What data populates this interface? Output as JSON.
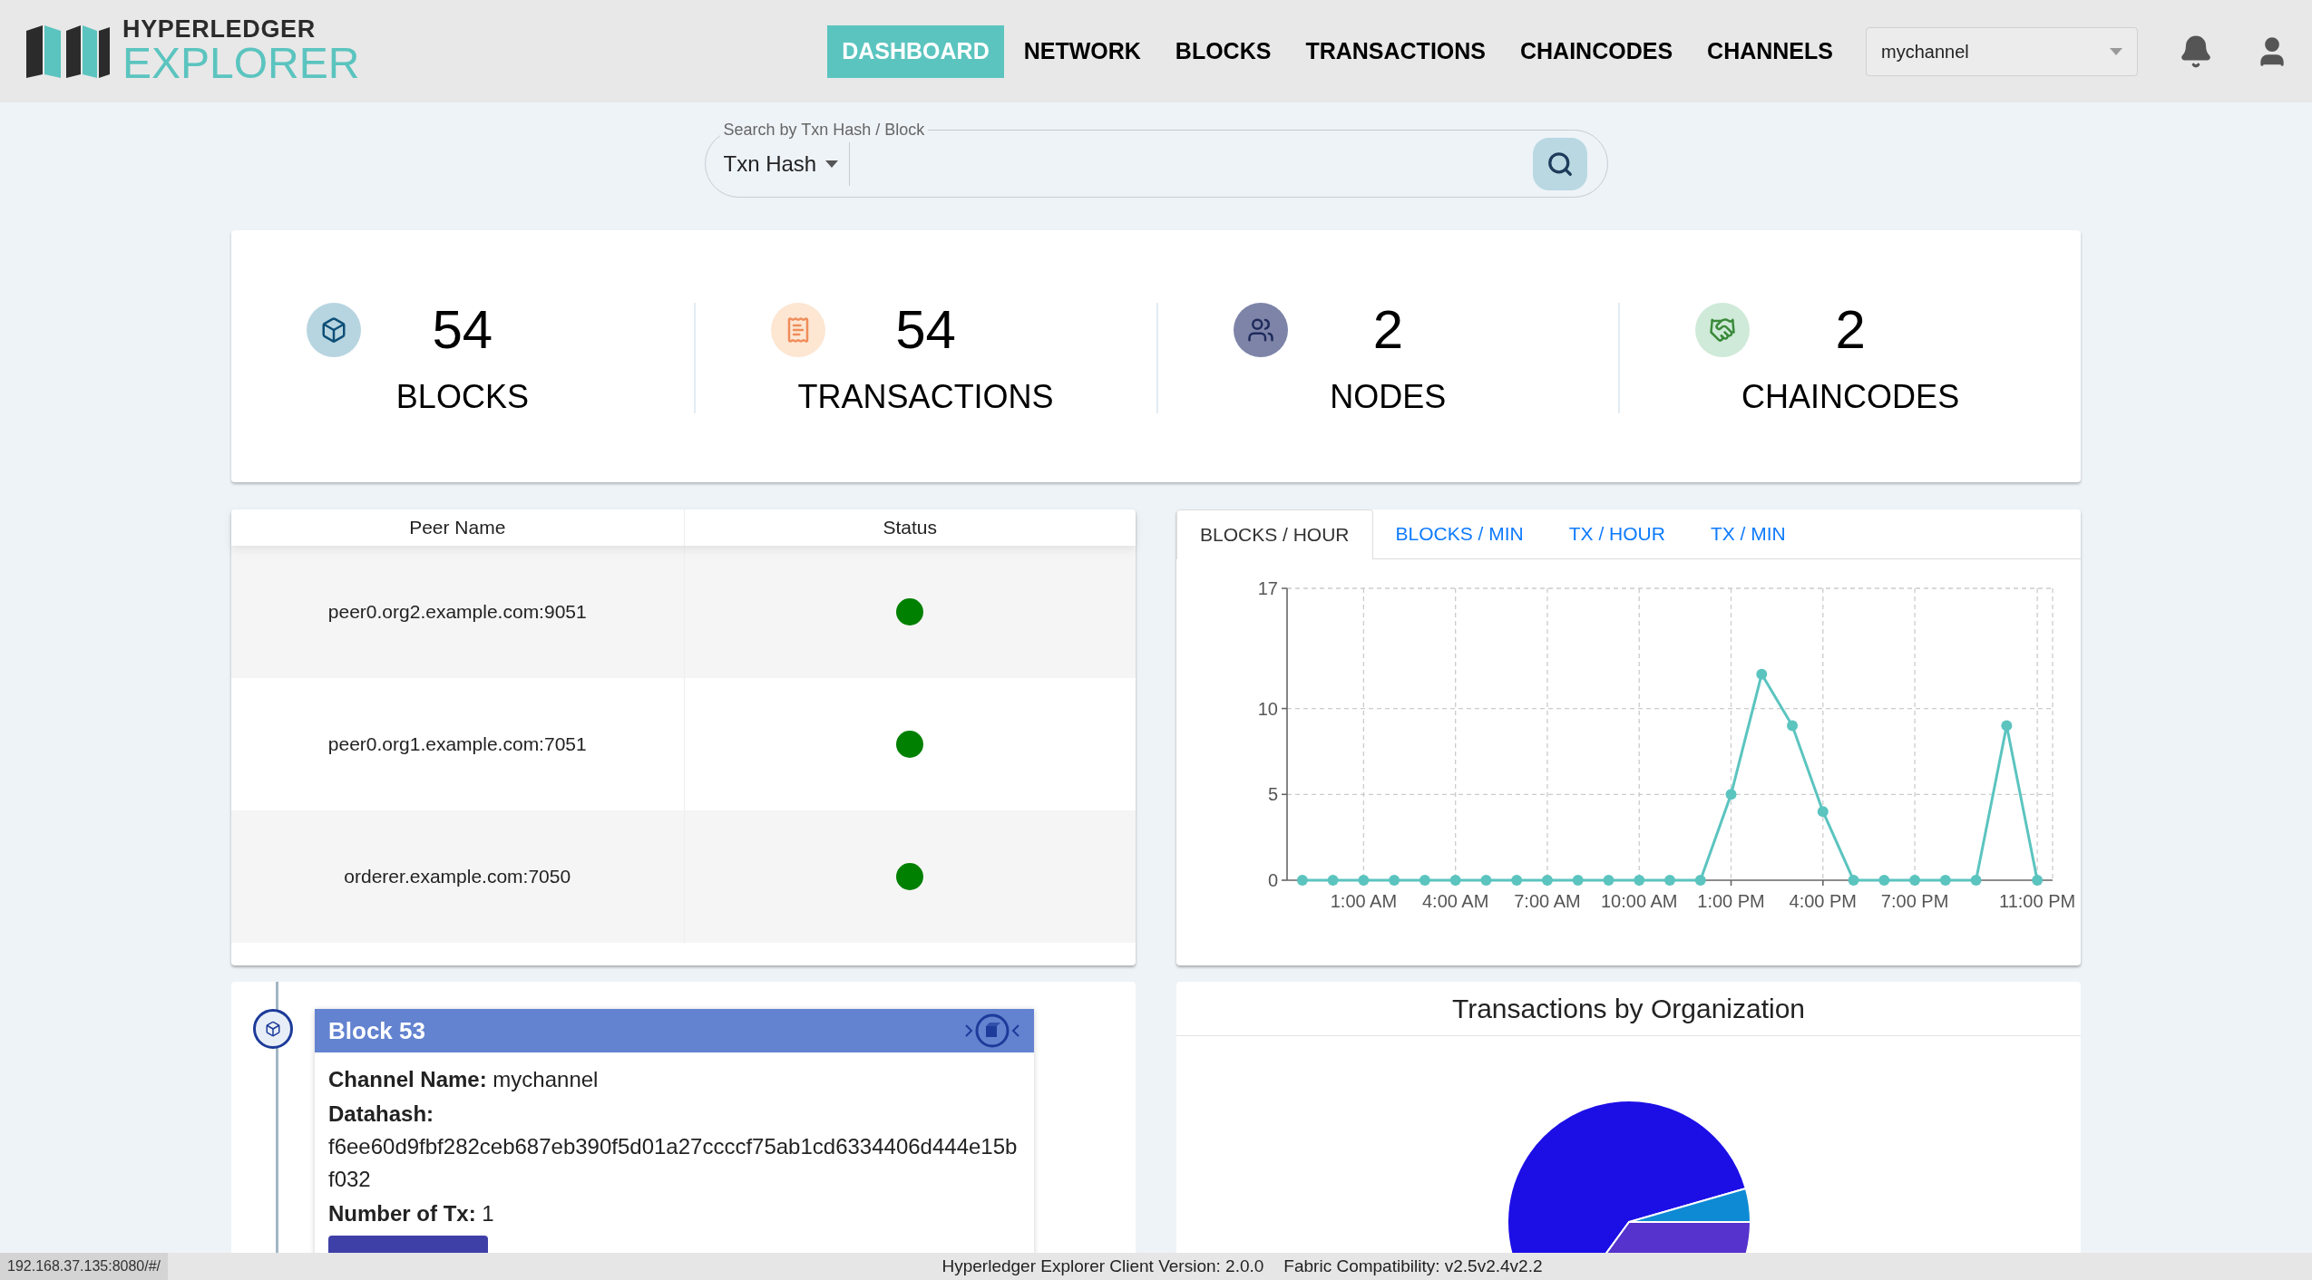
{
  "header": {
    "logo": {
      "line1": "HYPERLEDGER",
      "line2": "EXPLORER"
    },
    "nav": [
      {
        "label": "DASHBOARD",
        "selected": true
      },
      {
        "label": "NETWORK",
        "selected": false
      },
      {
        "label": "BLOCKS",
        "selected": false
      },
      {
        "label": "TRANSACTIONS",
        "selected": false
      },
      {
        "label": "CHAINCODES",
        "selected": false
      },
      {
        "label": "CHANNELS",
        "selected": false
      }
    ],
    "channel_select": {
      "value": "mychannel"
    }
  },
  "search": {
    "label": "Search by Txn Hash / Block",
    "type_select": "Txn Hash"
  },
  "stats": [
    {
      "kind": "blocks",
      "value": "54",
      "label": "BLOCKS"
    },
    {
      "kind": "transactions",
      "value": "54",
      "label": "TRANSACTIONS"
    },
    {
      "kind": "nodes",
      "value": "2",
      "label": "NODES"
    },
    {
      "kind": "chaincodes",
      "value": "2",
      "label": "CHAINCODES"
    }
  ],
  "peers": {
    "columns": [
      "Peer Name",
      "Status"
    ],
    "rows": [
      {
        "name": "peer0.org2.example.com:9051",
        "color": "#008000"
      },
      {
        "name": "peer0.org1.example.com:7051",
        "color": "#008000"
      },
      {
        "name": "orderer.example.com:7050",
        "color": "#008000"
      }
    ]
  },
  "activity": {
    "tabs": [
      {
        "label": "BLOCKS / HOUR",
        "selected": true
      },
      {
        "label": "BLOCKS / MIN",
        "selected": false
      },
      {
        "label": "TX / HOUR",
        "selected": false
      },
      {
        "label": "TX / MIN",
        "selected": false
      }
    ],
    "chart_data": {
      "type": "line",
      "categories": [
        null,
        null,
        "1:00 AM",
        null,
        null,
        "4:00 AM",
        null,
        null,
        "7:00 AM",
        null,
        null,
        "10:00 AM",
        null,
        null,
        "1:00 PM",
        null,
        null,
        "4:00 PM",
        null,
        null,
        "7:00 PM",
        null,
        null,
        null,
        "11:00 PM"
      ],
      "series": [
        {
          "color": "#5bc4bf",
          "marker": "circle",
          "values": [
            0,
            0,
            0,
            0,
            0,
            0,
            0,
            0,
            0,
            0,
            0,
            0,
            0,
            0,
            5,
            12,
            9,
            4,
            0,
            0,
            0,
            0,
            0,
            9,
            0
          ]
        }
      ],
      "ylim": [
        0,
        17
      ],
      "grid": true,
      "yticks": [
        0,
        5,
        10,
        17
      ]
    }
  },
  "latest_block": {
    "title": "Block 53",
    "fields": [
      "**Channel Name:** mychannel",
      "**Datahash:** f6ee60d9fbf282ceb687eb390f5d01a27ccccf75ab1cd6334406d444e15bf032",
      "**Number of Tx:** 1"
    ]
  },
  "org_chart": {
    "title": "Transactions by Organization"
  },
  "footer": {
    "url": "192.168.37.135:8080/#/",
    "version": "Hyperledger Explorer Client Version: 2.0.0",
    "compat": "Fabric Compatibility: v2.5v2.4v2.2"
  }
}
